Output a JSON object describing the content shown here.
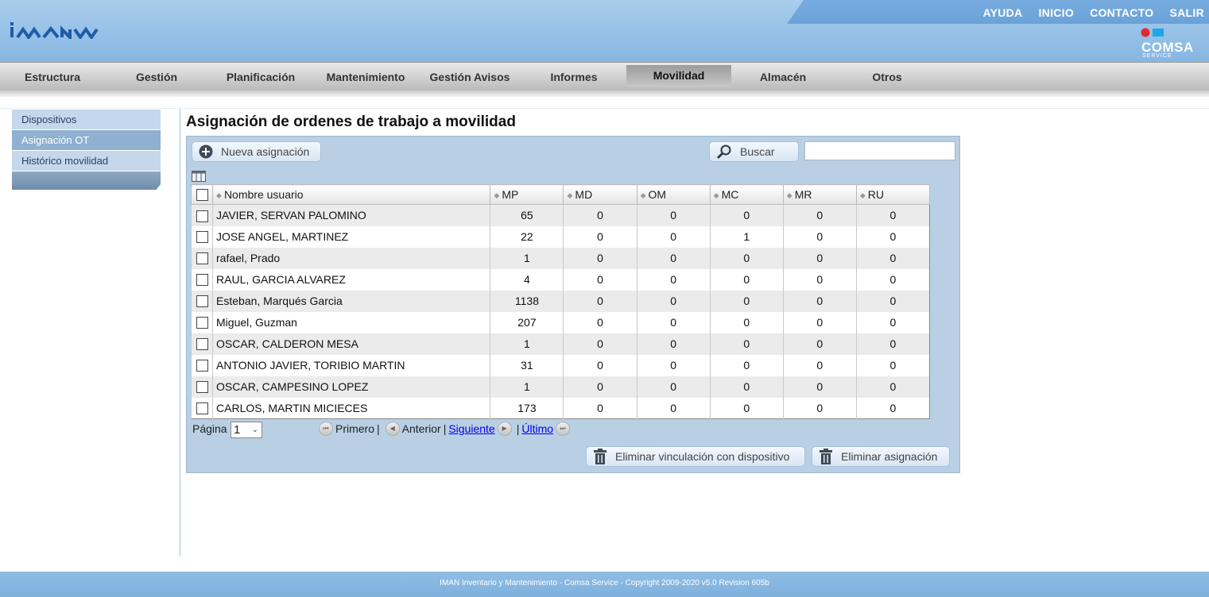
{
  "header": {
    "logo_text": "iman",
    "top_links": [
      "AYUDA",
      "INICIO",
      "CONTACTO",
      "SALIR"
    ],
    "brand": "COMSA",
    "brand_sub": "SERVICE"
  },
  "nav": {
    "items": [
      "Estructura",
      "Gestión",
      "Planificación",
      "Mantenimiento",
      "Gestión Avisos",
      "Informes",
      "Movilidad",
      "Almacén",
      "Otros"
    ],
    "active": "Movilidad"
  },
  "sidebar": {
    "items": [
      "Dispositivos",
      "Asignación OT",
      "Histórico movilidad"
    ],
    "active": "Asignación OT"
  },
  "main": {
    "title": "Asignación de ordenes de trabajo a movilidad",
    "new_button": "Nueva asignación",
    "search_button": "Buscar",
    "search_value": ""
  },
  "table": {
    "columns": [
      "Nombre usuario",
      "MP",
      "MD",
      "OM",
      "MC",
      "MR",
      "RU"
    ],
    "rows": [
      [
        "JAVIER, SERVAN PALOMINO",
        "65",
        "0",
        "0",
        "0",
        "0",
        "0"
      ],
      [
        "JOSE ANGEL, MARTINEZ",
        "22",
        "0",
        "0",
        "1",
        "0",
        "0"
      ],
      [
        "rafael, Prado",
        "1",
        "0",
        "0",
        "0",
        "0",
        "0"
      ],
      [
        "RAUL, GARCIA ALVAREZ",
        "4",
        "0",
        "0",
        "0",
        "0",
        "0"
      ],
      [
        "Esteban, Marqués Garcia",
        "1138",
        "0",
        "0",
        "0",
        "0",
        "0"
      ],
      [
        "Miguel, Guzman",
        "207",
        "0",
        "0",
        "0",
        "0",
        "0"
      ],
      [
        "OSCAR, CALDERON MESA",
        "1",
        "0",
        "0",
        "0",
        "0",
        "0"
      ],
      [
        "ANTONIO JAVIER, TORIBIO MARTIN",
        "31",
        "0",
        "0",
        "0",
        "0",
        "0"
      ],
      [
        "OSCAR, CAMPESINO LOPEZ",
        "1",
        "0",
        "0",
        "0",
        "0",
        "0"
      ],
      [
        "CARLOS, MARTIN MICIECES",
        "173",
        "0",
        "0",
        "0",
        "0",
        "0"
      ]
    ]
  },
  "pagination": {
    "label": "Página",
    "current": "1",
    "first": "Primero",
    "prev": "Anterior",
    "next": "Siguiente",
    "last": "Último",
    "sep": "|"
  },
  "actions": {
    "unlink_device": "Eliminar vinculación con dispositivo",
    "delete_assignment": "Eliminar asignación"
  },
  "footer": {
    "text": "IMAN Inventario y Mantenimiento - Comsa Service - Copyright 2009-2020 v5.0 Revision 605b"
  },
  "colors": {
    "header": "#8dbbe4",
    "panel": "#b9cfe4",
    "footer": "#87b7e0",
    "link": "#0000ee"
  }
}
